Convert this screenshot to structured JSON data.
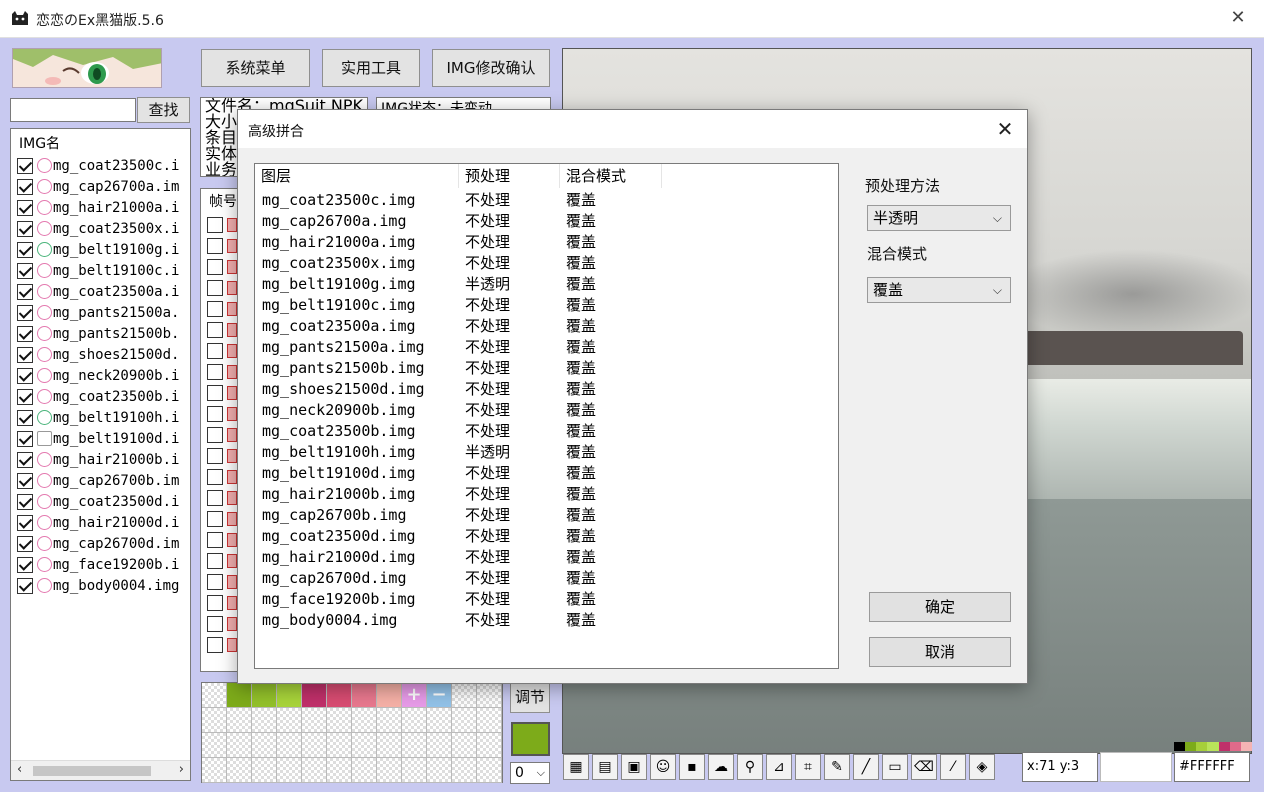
{
  "window": {
    "title": "恋恋のEx黑猫版.5.6",
    "close_glyph": "✕"
  },
  "search": {
    "value": "",
    "button": "查找"
  },
  "img_list": {
    "header": "IMG名",
    "items": [
      {
        "name": "mg_coat23500c.i",
        "icon": "pink"
      },
      {
        "name": "mg_cap26700a.im",
        "icon": "pink"
      },
      {
        "name": "mg_hair21000a.i",
        "icon": "pink"
      },
      {
        "name": "mg_coat23500x.i",
        "icon": "pink"
      },
      {
        "name": "mg_belt19100g.i",
        "icon": "green"
      },
      {
        "name": "mg_belt19100c.i",
        "icon": "pink"
      },
      {
        "name": "mg_coat23500a.i",
        "icon": "pink"
      },
      {
        "name": "mg_pants21500a.",
        "icon": "pink"
      },
      {
        "name": "mg_pants21500b.",
        "icon": "pink"
      },
      {
        "name": "mg_shoes21500d.",
        "icon": "pink"
      },
      {
        "name": "mg_neck20900b.i",
        "icon": "pink"
      },
      {
        "name": "mg_coat23500b.i",
        "icon": "pink"
      },
      {
        "name": "mg_belt19100h.i",
        "icon": "green"
      },
      {
        "name": "mg_belt19100d.i",
        "icon": "grid"
      },
      {
        "name": "mg_hair21000b.i",
        "icon": "pink"
      },
      {
        "name": "mg_cap26700b.im",
        "icon": "pink"
      },
      {
        "name": "mg_coat23500d.i",
        "icon": "pink"
      },
      {
        "name": "mg_hair21000d.i",
        "icon": "pink"
      },
      {
        "name": "mg_cap26700d.im",
        "icon": "pink"
      },
      {
        "name": "mg_face19200b.i",
        "icon": "pink"
      },
      {
        "name": "mg_body0004.img",
        "icon": "pink"
      }
    ]
  },
  "menu": {
    "system": "系统菜单",
    "tools": "实用工具",
    "img_confirm": "IMG修改确认"
  },
  "info": {
    "line1": "文件名：mgSuit.NPK",
    "line2": "大小",
    "line3": "条目",
    "line4": "实体",
    "line5": "业务",
    "state": "IMG状态：未变动"
  },
  "frame_list": {
    "header": "帧号"
  },
  "palette": {
    "plus": "+",
    "minus": "−"
  },
  "adjust": {
    "label": "调节"
  },
  "zero_select": {
    "value": "0"
  },
  "status": {
    "coord": "x:71 y:3",
    "hex": "#FFFFFF"
  },
  "colors": {
    "accent_swatch": "#7dab1a",
    "client_bg": "#c8c9f0"
  },
  "dialog": {
    "title": "高级拼合",
    "close_glyph": "✕",
    "columns": [
      "图层",
      "预处理",
      "混合模式"
    ],
    "rows": [
      {
        "layer": "mg_coat23500c.img",
        "pre": "不处理",
        "blend": "覆盖"
      },
      {
        "layer": "mg_cap26700a.img",
        "pre": "不处理",
        "blend": "覆盖"
      },
      {
        "layer": "mg_hair21000a.img",
        "pre": "不处理",
        "blend": "覆盖"
      },
      {
        "layer": "mg_coat23500x.img",
        "pre": "不处理",
        "blend": "覆盖"
      },
      {
        "layer": "mg_belt19100g.img",
        "pre": "半透明",
        "blend": "覆盖"
      },
      {
        "layer": "mg_belt19100c.img",
        "pre": "不处理",
        "blend": "覆盖"
      },
      {
        "layer": "mg_coat23500a.img",
        "pre": "不处理",
        "blend": "覆盖"
      },
      {
        "layer": "mg_pants21500a.img",
        "pre": "不处理",
        "blend": "覆盖"
      },
      {
        "layer": "mg_pants21500b.img",
        "pre": "不处理",
        "blend": "覆盖"
      },
      {
        "layer": "mg_shoes21500d.img",
        "pre": "不处理",
        "blend": "覆盖"
      },
      {
        "layer": "mg_neck20900b.img",
        "pre": "不处理",
        "blend": "覆盖"
      },
      {
        "layer": "mg_coat23500b.img",
        "pre": "不处理",
        "blend": "覆盖"
      },
      {
        "layer": "mg_belt19100h.img",
        "pre": "半透明",
        "blend": "覆盖"
      },
      {
        "layer": "mg_belt19100d.img",
        "pre": "不处理",
        "blend": "覆盖"
      },
      {
        "layer": "mg_hair21000b.img",
        "pre": "不处理",
        "blend": "覆盖"
      },
      {
        "layer": "mg_cap26700b.img",
        "pre": "不处理",
        "blend": "覆盖"
      },
      {
        "layer": "mg_coat23500d.img",
        "pre": "不处理",
        "blend": "覆盖"
      },
      {
        "layer": "mg_hair21000d.img",
        "pre": "不处理",
        "blend": "覆盖"
      },
      {
        "layer": "mg_cap26700d.img",
        "pre": "不处理",
        "blend": "覆盖"
      },
      {
        "layer": "mg_face19200b.img",
        "pre": "不处理",
        "blend": "覆盖"
      },
      {
        "layer": "mg_body0004.img",
        "pre": "不处理",
        "blend": "覆盖"
      }
    ],
    "pre_label": "预处理方法",
    "pre_value": "半透明",
    "blend_label": "混合模式",
    "blend_value": "覆盖",
    "ok": "确定",
    "cancel": "取消"
  }
}
